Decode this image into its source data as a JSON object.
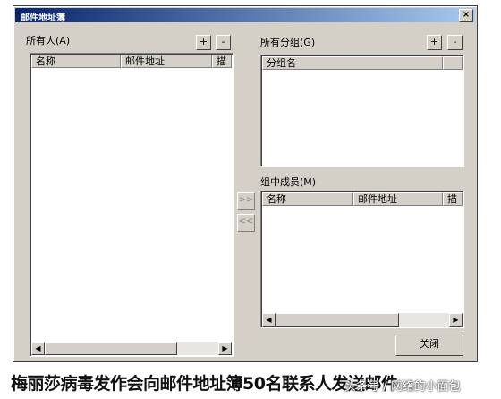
{
  "window": {
    "title": "邮件地址簿",
    "close_glyph": "×"
  },
  "all_people": {
    "label": "所有人(A)",
    "add_label": "+",
    "remove_label": "-",
    "columns": [
      "名称",
      "邮件地址",
      "描"
    ]
  },
  "all_groups": {
    "label": "所有分组(G)",
    "add_label": "+",
    "remove_label": "-",
    "columns": [
      "分组名"
    ]
  },
  "group_members": {
    "label": "组中成员(M)",
    "columns": [
      "名称",
      "邮件地址",
      "描"
    ]
  },
  "move": {
    "add_label": ">>",
    "remove_label": "<<"
  },
  "scroll": {
    "left_glyph": "◀",
    "right_glyph": "▶"
  },
  "close_button_label": "关闭",
  "caption": "梅丽莎病毒发作会向邮件地址簿50名联系人发送邮件",
  "watermark": "头条号 / 网络的小面包"
}
